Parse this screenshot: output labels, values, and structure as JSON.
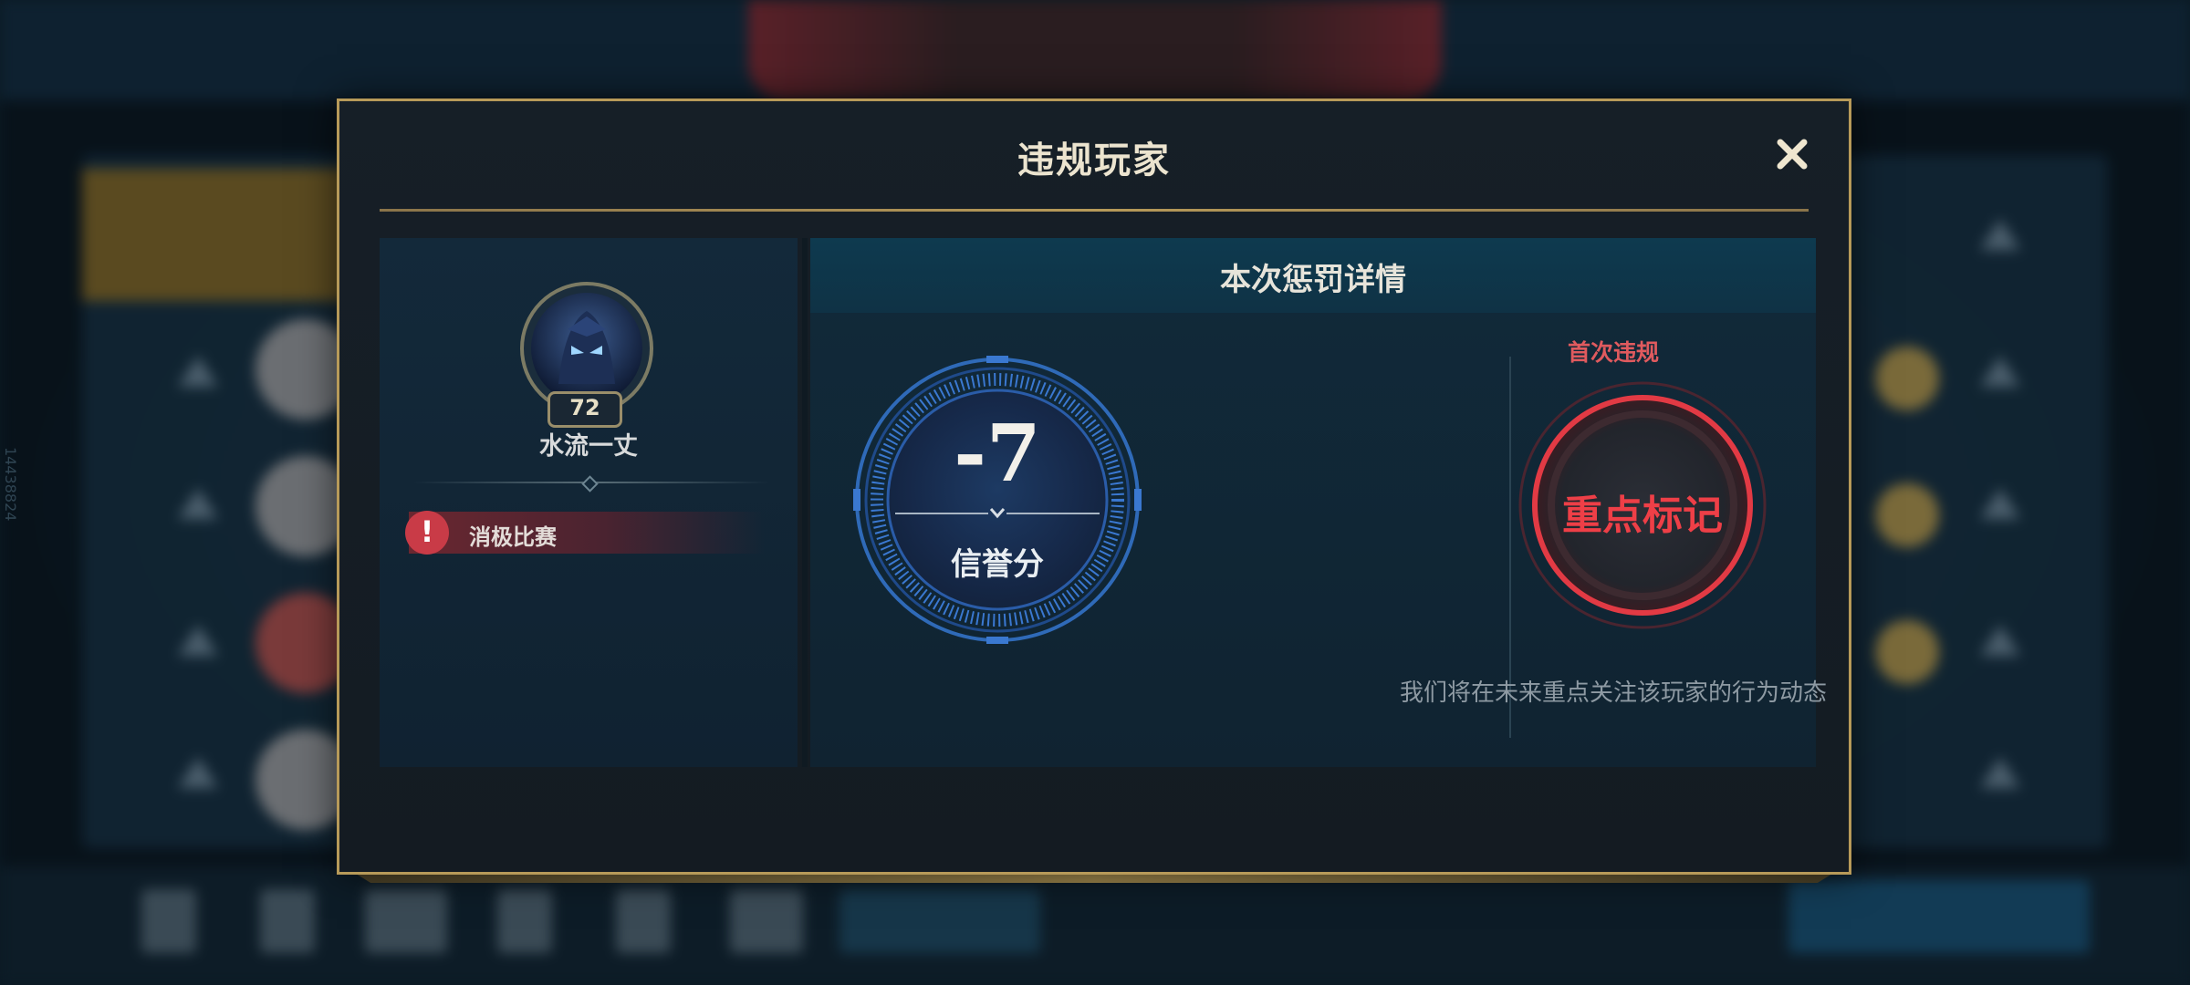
{
  "background": {
    "side_id": "14438824"
  },
  "dialog": {
    "title": "违规玩家",
    "close_icon": "close-icon",
    "accent_color": "#b79a59"
  },
  "player": {
    "name": "水流一丈",
    "level": "72",
    "violation": {
      "icon": "exclamation-icon",
      "label": "消极比赛",
      "color": "#c93b47"
    }
  },
  "penalty": {
    "header": "本次惩罚详情",
    "score": {
      "value": "-7",
      "label": "信誉分"
    },
    "mark": {
      "badge": "首次违规",
      "label": "重点标记",
      "description": "我们将在未来重点关注该玩家的行为动态",
      "color": "#ee3f47"
    }
  }
}
